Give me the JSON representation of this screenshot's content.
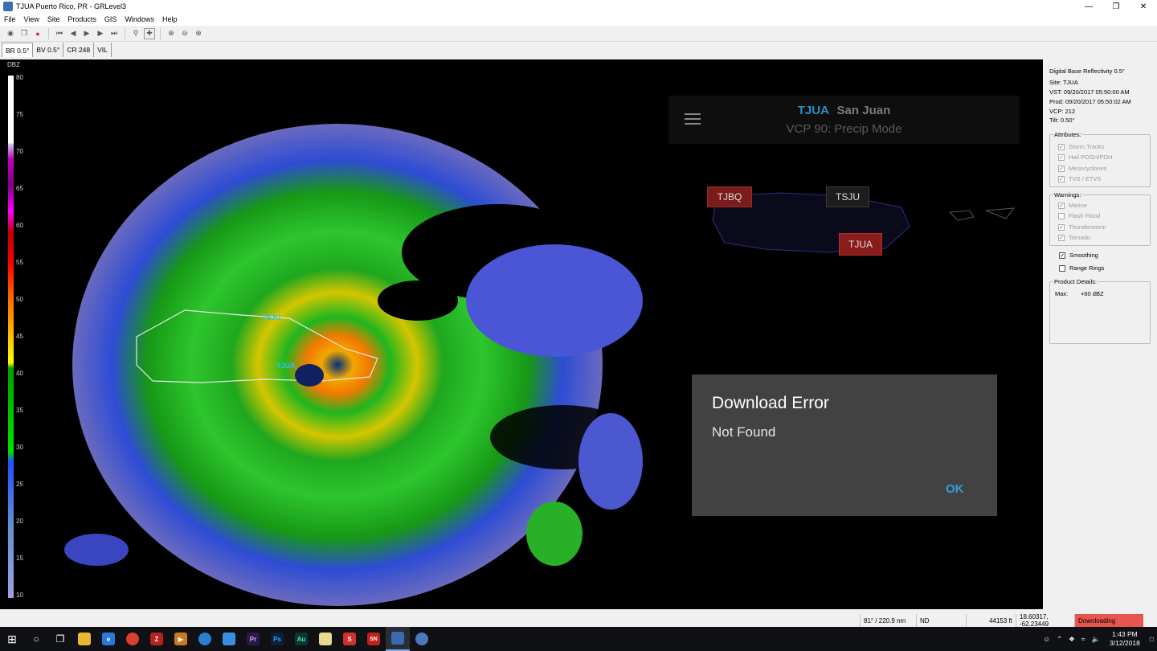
{
  "window": {
    "title": "TJUA Puerto Rico, PR - GRLevel3",
    "controls": [
      "—",
      "❐",
      "✕"
    ]
  },
  "menu": [
    "File",
    "View",
    "Site",
    "Products",
    "GIS",
    "Windows",
    "Help"
  ],
  "product_tabs": [
    "BR 0.5°",
    "BV 0.5°",
    "CR 248",
    "VIL"
  ],
  "scale": {
    "unit": "DBZ",
    "ticks": [
      "80",
      "75",
      "70",
      "65",
      "60",
      "55",
      "50",
      "45",
      "40",
      "35",
      "30",
      "25",
      "20",
      "15",
      "10"
    ]
  },
  "map_labels": {
    "tsju": "TSJU",
    "tjua": "TJUA"
  },
  "overlay": {
    "site_code": "TJUA",
    "site_name": "San Juan",
    "vcp": "VCP 90: Precip Mode",
    "menu_icon": "hamburger-menu-icon",
    "markers": [
      "TJBQ",
      "TSJU",
      "TJUA"
    ]
  },
  "dialog": {
    "title": "Download Error",
    "message": "Not Found",
    "ok_label": "OK"
  },
  "panel": {
    "product": "Digital Base Reflectivity 0.5°",
    "site": "Site:  TJUA",
    "vst": "VST:  09/20/2017  05:50:00 AM",
    "prod": "Prod: 09/20/2017  05:50:02 AM",
    "vcp": "VCP:  212",
    "tilt": "Tilt:   0.50°",
    "attributes_title": "Attributes:",
    "attributes": [
      "Storm Tracks",
      "Hail POSH/POH",
      "Mesocyclones",
      "TVS / ETVS"
    ],
    "warnings_title": "Warnings:",
    "warnings": [
      "Marine",
      "Flash Flood",
      "Thunderstorm",
      "Tornado"
    ],
    "smoothing": "Smoothing",
    "range_rings": "Range Rings",
    "details_title": "Product Details:",
    "details_max_label": "Max:",
    "details_max_value": "+60 dBZ"
  },
  "status": {
    "azimuth": "81° / 220.9 nm",
    "value": "ND",
    "height": "44153 ft",
    "coords": "18.60317, -62.23449",
    "state": "Downloading",
    "state_color": "#e8544e"
  },
  "taskbar": {
    "time": "1:43 PM",
    "date": "3/12/2018"
  }
}
